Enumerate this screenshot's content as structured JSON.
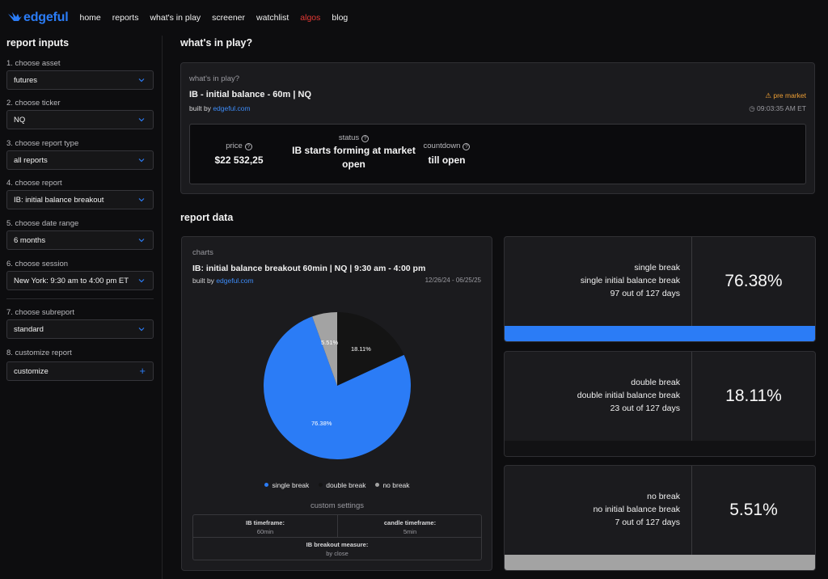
{
  "nav": {
    "logo": "edgeful",
    "links": [
      "home",
      "reports",
      "what's in play",
      "screener",
      "watchlist",
      "algos",
      "blog"
    ]
  },
  "sidebar": {
    "title": "report inputs",
    "fields": [
      {
        "label": "1. choose asset",
        "value": "futures"
      },
      {
        "label": "2. choose ticker",
        "value": "NQ"
      },
      {
        "label": "3. choose report type",
        "value": "all reports"
      },
      {
        "label": "4. choose report",
        "value": "IB: initial balance breakout"
      },
      {
        "label": "5. choose date range",
        "value": "6 months"
      },
      {
        "label": "6. choose session",
        "value": "New York: 9:30 am to 4:00 pm ET"
      },
      {
        "label": "7. choose subreport",
        "value": "standard"
      },
      {
        "label": "8. customize report",
        "value": "customize"
      }
    ]
  },
  "wip": {
    "heading": "what's in play?",
    "sub": "what's in play?",
    "title": "IB - initial balance - 60m | NQ",
    "built_by": "built by",
    "built_link": "edgeful.com",
    "pre_market": "pre market",
    "time": "09:03:35 AM ET",
    "price_label": "price",
    "price_value": "$22 532,25",
    "status_label": "status",
    "status_value": "IB starts forming at market open",
    "countdown_label": "countdown",
    "countdown_value": "till open"
  },
  "report": {
    "heading": "report data",
    "charts_sub": "charts",
    "chart_title": "IB: initial balance breakout 60min | NQ | 9:30 am - 4:00 pm",
    "built_by": "built by",
    "built_link": "edgeful.com",
    "date_range": "12/26/24 - 06/25/25",
    "custom_settings_title": "custom settings",
    "custom_settings": [
      {
        "key": "IB timeframe:",
        "value": "60min"
      },
      {
        "key": "candle timeframe:",
        "value": "5min"
      },
      {
        "key": "IB breakout measure:",
        "value": "by close"
      }
    ],
    "stats": [
      {
        "line1": "single break",
        "line2": "single initial balance break",
        "line3": "97 out of 127 days",
        "pct": "76.38%"
      },
      {
        "line1": "double break",
        "line2": "double initial balance break",
        "line3": "23 out of 127 days",
        "pct": "18.11%"
      },
      {
        "line1": "no break",
        "line2": "no initial balance break",
        "line3": "7 out of 127 days",
        "pct": "5.51%"
      }
    ]
  },
  "chart_data": {
    "type": "pie",
    "labels": [
      "single break",
      "double break",
      "no break"
    ],
    "values": [
      76.38,
      18.11,
      5.51
    ],
    "slice_labels": [
      "76.38%",
      "18.11%",
      "5.51%"
    ],
    "colors": [
      "#2b7cf6",
      "#141414",
      "#a3a3a3"
    ],
    "legend": "bottom"
  }
}
